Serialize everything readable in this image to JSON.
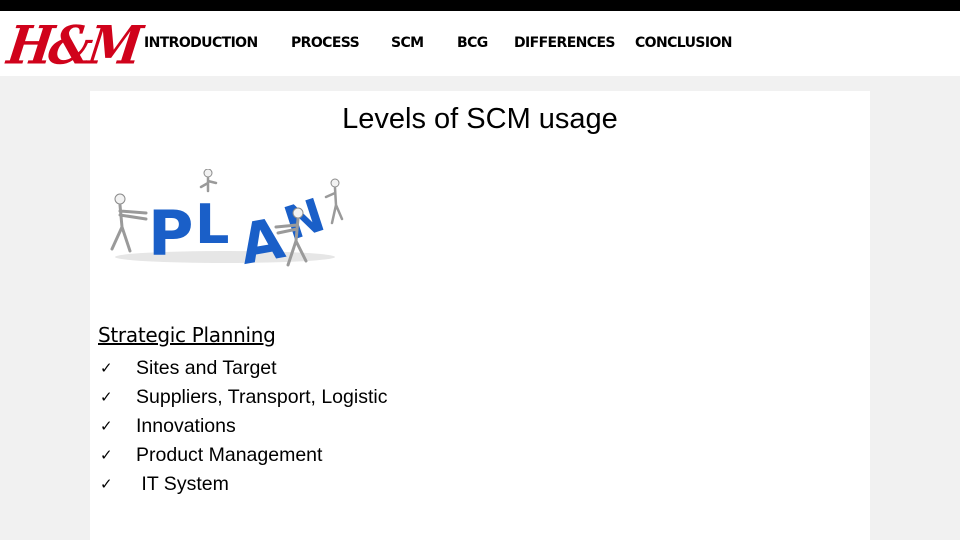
{
  "brand": {
    "logo_text": "H&M",
    "logo_color": "#d0021b"
  },
  "nav": {
    "items": [
      {
        "label": "INTRODUCTION"
      },
      {
        "label": "PROCESS"
      },
      {
        "label": "SCM"
      },
      {
        "label": "BCG"
      },
      {
        "label": "DIFFERENCES"
      },
      {
        "label": "CONCLUSION"
      }
    ]
  },
  "slide": {
    "title": "Levels of SCM usage",
    "image": {
      "icon": "plan-blocks-illustration",
      "letters": "PLAN",
      "color": "#1a5fc8"
    },
    "section_title": "Strategic Planning",
    "bullet_icon": "check-icon",
    "bullet_glyph": "✓",
    "bullets": [
      "Sites and Target",
      "Suppliers, Transport, Logistic",
      "Innovations",
      "Product Management",
      " IT System"
    ]
  }
}
